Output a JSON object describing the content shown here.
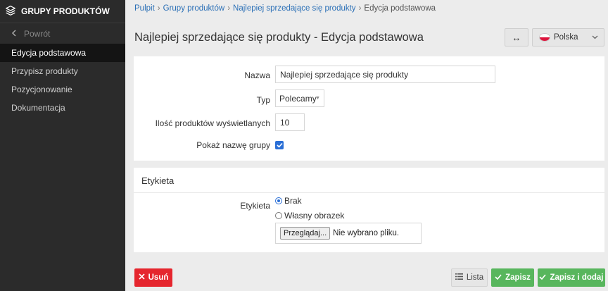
{
  "sidebar": {
    "title": "GRUPY PRODUKTÓW",
    "back_label": "Powrót",
    "items": [
      {
        "label": "Edycja podstawowa",
        "active": true
      },
      {
        "label": "Przypisz produkty"
      },
      {
        "label": "Pozycjonowanie"
      },
      {
        "label": "Dokumentacja"
      }
    ]
  },
  "breadcrumb": {
    "items": [
      "Pulpit",
      "Grupy produktów",
      "Najlepiej sprzedające się produkty"
    ],
    "current": "Edycja podstawowa",
    "separator": "›"
  },
  "page": {
    "title": "Najlepiej sprzedające się produkty - Edycja podstawowa"
  },
  "toolbar": {
    "resize_icon": "↔",
    "language": "Polska"
  },
  "form": {
    "name_label": "Nazwa",
    "name_value": "Najlepiej sprzedające się produkty",
    "type_label": "Typ",
    "type_value": "Polecamy",
    "count_label": "Ilość produktów wyświetlanych",
    "count_value": "10",
    "show_name_label": "Pokaż nazwę grupy",
    "show_name_checked": true
  },
  "label_section": {
    "title": "Etykieta",
    "field_label": "Etykieta",
    "options": [
      {
        "label": "Brak",
        "selected": true
      },
      {
        "label": "Własny obrazek",
        "selected": false
      }
    ],
    "file_button": "Przeglądaj...",
    "file_status": "Nie wybrano pliku."
  },
  "actions": {
    "delete": "Usuń",
    "list": "Lista",
    "save": "Zapisz",
    "save_add": "Zapisz i dodaj"
  },
  "colors": {
    "sidebar_bg": "#2b2b2b",
    "link": "#2a6fb6",
    "danger": "#e5262e",
    "success": "#58b65d",
    "accent": "#2a6fd6"
  }
}
